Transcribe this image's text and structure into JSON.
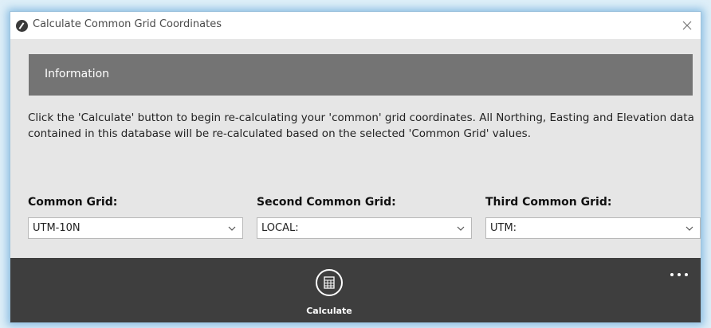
{
  "window": {
    "title": "Calculate Common Grid Coordinates",
    "close_icon": "close-icon",
    "app_icon": "app-logo-icon"
  },
  "info": {
    "header": "Information",
    "description": "Click the 'Calculate' button to begin re-calculating your 'common' grid coordinates. All Northing, Easting and Elevation data contained in this database will be re-calculated based on the selected 'Common Grid' values."
  },
  "fields": [
    {
      "label": "Common Grid:",
      "value": "UTM-10N"
    },
    {
      "label": "Second Common Grid:",
      "value": "LOCAL:"
    },
    {
      "label": "Third Common Grid:",
      "value": "UTM:"
    }
  ],
  "toolbar": {
    "calculate_label": "Calculate",
    "calculate_icon": "calculator-icon",
    "more_icon": "more-options-icon"
  },
  "colors": {
    "header_bg": "#747474",
    "toolbar_bg": "#3e3e3e",
    "window_bg": "#e6e6e6",
    "window_glow": "#4696d2"
  }
}
